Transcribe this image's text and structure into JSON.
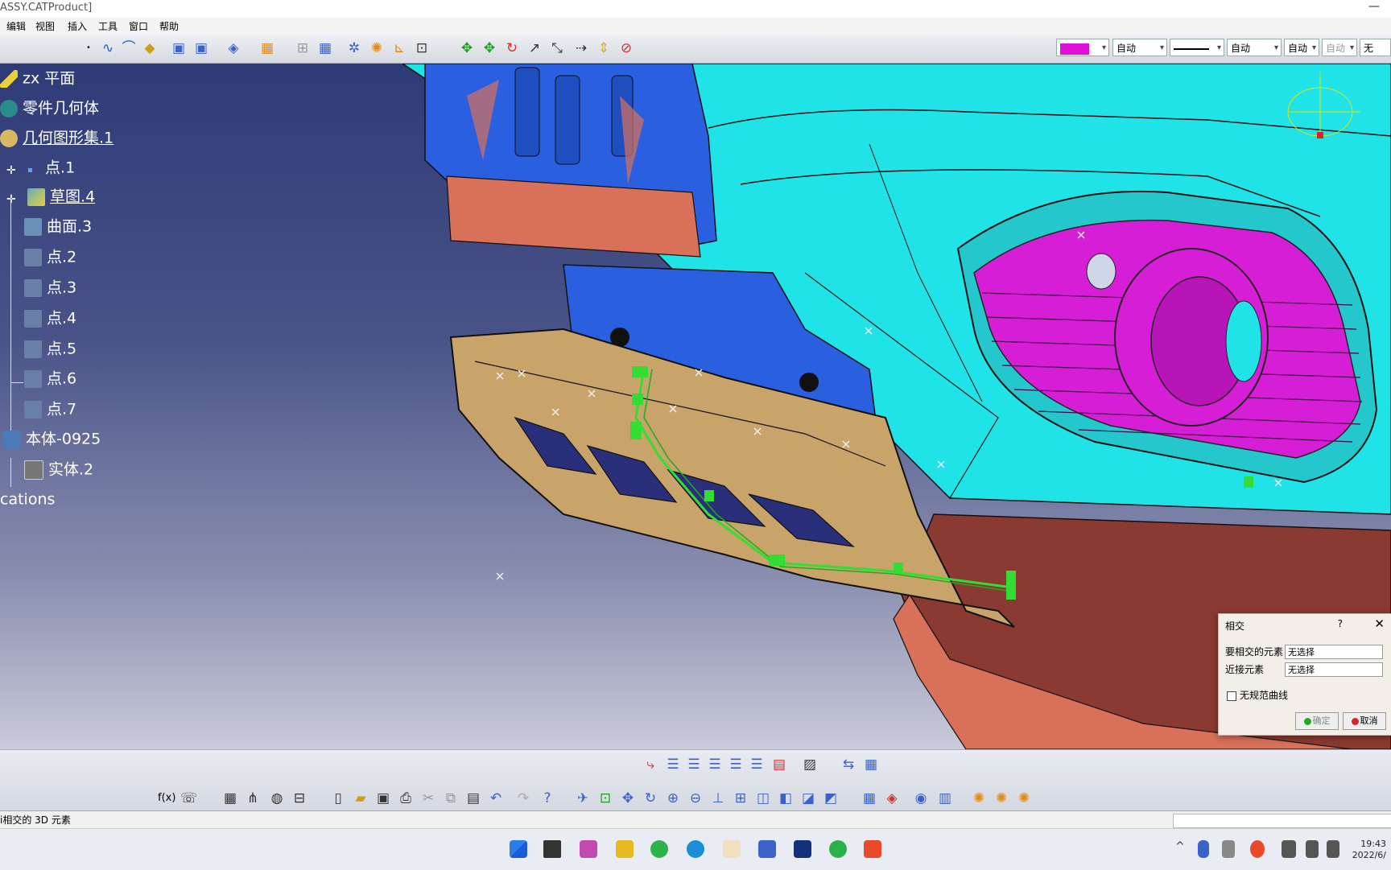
{
  "window": {
    "title": "ASSY.CATProduct]",
    "minimize_glyph": "—"
  },
  "menu": [
    "编辑",
    "视图",
    "插入",
    "工具",
    "窗口",
    "帮助"
  ],
  "properties": {
    "color_swatch": "#e010d8",
    "fields": [
      "自动",
      "自动",
      "自动",
      "自动"
    ],
    "last_field": "无"
  },
  "tree": {
    "items": [
      {
        "label": "zx 平面",
        "icon": "plane-icon",
        "underline": false
      },
      {
        "label": "零件几何体",
        "icon": "part-body-icon",
        "underline": false
      },
      {
        "label": "几何图形集.1",
        "icon": "geometrical-set-icon",
        "underline": true
      },
      {
        "label": "点.1",
        "icon": "point-icon",
        "underline": false
      },
      {
        "label": "草图.4",
        "icon": "sketch-icon",
        "underline": true
      },
      {
        "label": "曲面.3",
        "icon": "surface-icon",
        "underline": false
      },
      {
        "label": "点.2",
        "icon": "point-icon",
        "underline": false
      },
      {
        "label": "点.3",
        "icon": "point-icon",
        "underline": false
      },
      {
        "label": "点.4",
        "icon": "point-icon",
        "underline": false
      },
      {
        "label": "点.5",
        "icon": "point-icon",
        "underline": false
      },
      {
        "label": "点.6",
        "icon": "point-icon",
        "underline": false
      },
      {
        "label": "点.7",
        "icon": "point-icon",
        "underline": false
      },
      {
        "label": "本体-0925",
        "icon": "body-icon",
        "underline": false
      },
      {
        "label": "实体.2",
        "icon": "solid-icon",
        "underline": false
      },
      {
        "label": "cations",
        "icon": "",
        "underline": false
      }
    ]
  },
  "dialog": {
    "title": "相交",
    "help": "?",
    "close": "✕",
    "first_label": "要相交的元素",
    "first_value": "无选择",
    "second_label": "近接元素",
    "second_value": "无选择",
    "checkbox_label": "无规范曲线",
    "ok_label": "确定",
    "cancel_label": "取消",
    "ok_color": "#22aa22",
    "cancel_color": "#dd2222"
  },
  "status": {
    "text": "i相交的 3D 元素"
  },
  "clock": {
    "time": "19:43",
    "date": "2022/6/"
  },
  "colors": {
    "cyan_body": "#1fe3e6",
    "magenta_grille": "#d61ed6",
    "blue_bracket": "#2a5fe0",
    "tan_plate": "#c8a46a",
    "salmon": "#d8705a",
    "green_sketch": "#33dd33"
  }
}
